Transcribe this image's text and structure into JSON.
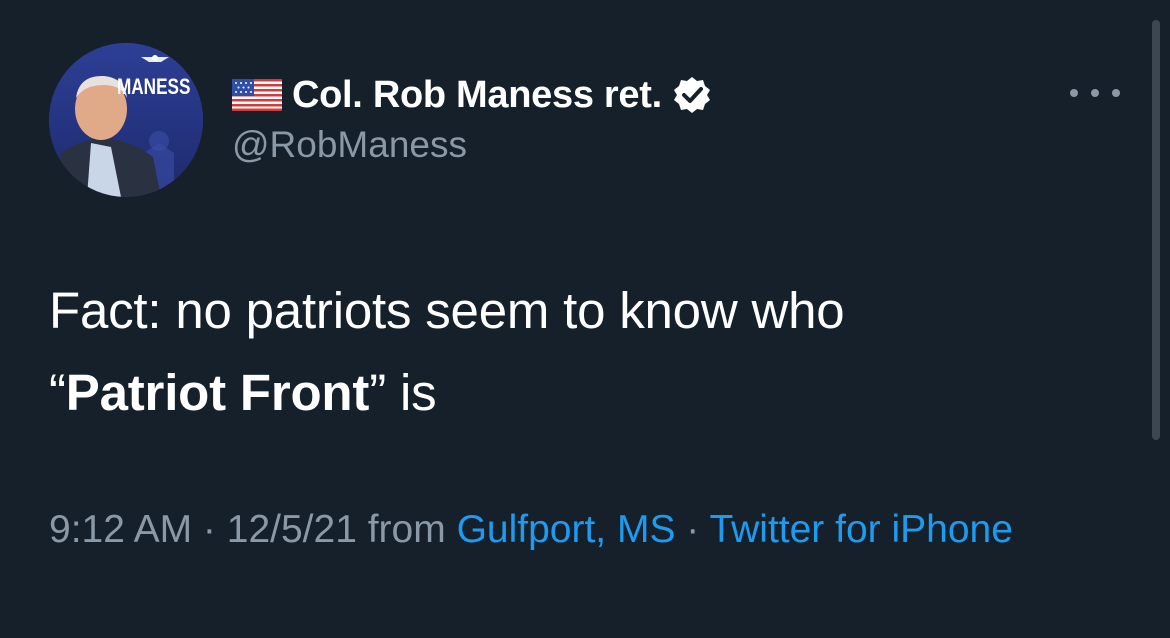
{
  "tweet": {
    "avatar_logo_text": "MANESS",
    "display_name": "Col. Rob Maness ret.",
    "handle": "@RobManess",
    "flag_icon": "us-flag-icon",
    "verified_icon": "verified-badge-icon",
    "more_icon": "more-options-icon",
    "text_part1": "Fact: no patriots seem to know who",
    "text_open_quote": "“",
    "text_bold": "Patriot Front",
    "text_close_quote": "”",
    "text_end": " is",
    "time": "9:12 AM",
    "separator": " · ",
    "date": "12/5/21",
    "from_label": " from ",
    "location": "Gulfport, MS",
    "source": "Twitter for iPhone"
  },
  "colors": {
    "background": "#15202b",
    "primary_text": "#ffffff",
    "secondary_text": "#8b98a5",
    "link": "#1d9bf0"
  }
}
